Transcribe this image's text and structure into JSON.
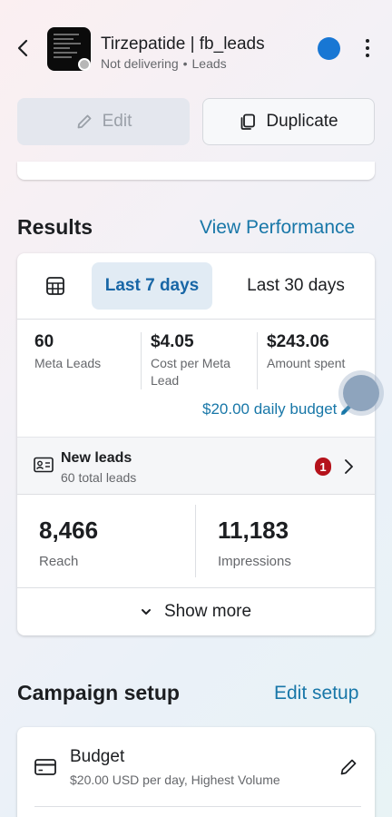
{
  "header": {
    "title": "Tirzepatide | fb_leads",
    "status": "Not delivering",
    "separator": "•",
    "objective": "Leads",
    "icons": {
      "back": "back-arrow-icon",
      "more": "more-vertical-icon",
      "profile": "profile-dot"
    },
    "colors": {
      "profile_dot": "#1877d4"
    }
  },
  "actions": {
    "edit_label": "Edit",
    "duplicate_label": "Duplicate"
  },
  "results": {
    "title": "Results",
    "view_performance": "View Performance",
    "tabs": [
      {
        "label": "Last 7 days",
        "active": true
      },
      {
        "label": "Last 30 days",
        "active": false
      }
    ],
    "metrics": [
      {
        "value": "60",
        "label": "Meta Leads"
      },
      {
        "value": "$4.05",
        "label": "Cost per Meta Lead"
      },
      {
        "value": "$243.06",
        "label": "Amount spent"
      }
    ],
    "budget_link": "$20.00 daily budget",
    "new_leads": {
      "title": "New leads",
      "subtitle": "60 total leads",
      "badge": "1"
    },
    "reach": {
      "value": "8,466",
      "label": "Reach"
    },
    "impressions": {
      "value": "11,183",
      "label": "Impressions"
    },
    "show_more": "Show more"
  },
  "campaign_setup": {
    "title": "Campaign setup",
    "edit_link": "Edit setup",
    "budget": {
      "title": "Budget",
      "subtitle": "$20.00 USD per day, Highest Volume"
    }
  },
  "colors": {
    "accent_link": "#1877a8",
    "active_tab_bg": "#e1ebf4",
    "badge": "#b5121b"
  }
}
